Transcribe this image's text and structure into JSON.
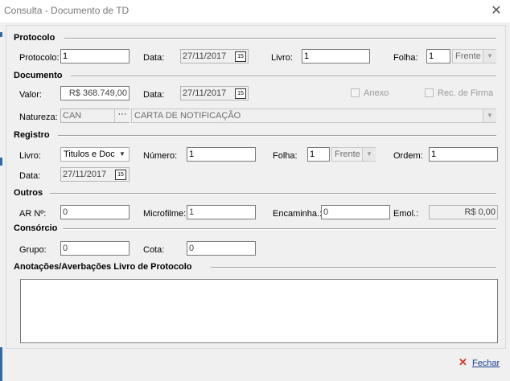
{
  "window": {
    "title": "Consulta - Documento de TD"
  },
  "sections": {
    "protocolo": "Protocolo",
    "documento": "Documento",
    "registro": "Registro",
    "outros": "Outros",
    "consorcio": "Consórcio",
    "anotacoes": "Anotações/Averbações Livro de Protocolo"
  },
  "protocolo": {
    "protocolo_label": "Protocolo:",
    "protocolo_value": "1",
    "data_label": "Data:",
    "data_value": "27/11/2017",
    "livro_label": "Livro:",
    "livro_value": "1",
    "folha_label": "Folha:",
    "folha_value": "1",
    "folha_side": "Frente"
  },
  "documento": {
    "valor_label": "Valor:",
    "valor_value": "R$ 368.749,00",
    "data_label": "Data:",
    "data_value": "27/11/2017",
    "anexo_label": "Anexo",
    "rec_firma_label": "Rec. de Firma",
    "natureza_label": "Natureza:",
    "natureza_code": "CAN",
    "natureza_desc": "CARTA DE NOTIFICAÇÃO"
  },
  "registro": {
    "livro_label": "Livro:",
    "livro_value": "Titulos e Doc",
    "numero_label": "Número:",
    "numero_value": "1",
    "folha_label": "Folha:",
    "folha_value": "1",
    "folha_side": "Frente",
    "ordem_label": "Ordem:",
    "ordem_value": "1",
    "data_label": "Data:",
    "data_value": "27/11/2017"
  },
  "outros": {
    "ar_label": "AR Nº:",
    "ar_value": "0",
    "microfilme_label": "Microfilme:",
    "microfilme_value": "1",
    "encaminha_label": "Encaminha.:",
    "encaminha_value": "0",
    "emol_label": "Emol.:",
    "emol_value": "R$ 0,00"
  },
  "consorcio": {
    "grupo_label": "Grupo:",
    "grupo_value": "0",
    "cota_label": "Cota:",
    "cota_value": "0"
  },
  "footer": {
    "fechar_label": "Fechar"
  },
  "icons": {
    "calendar": "15",
    "dropdown": "▼",
    "ellipsis": "···",
    "close": "✕"
  },
  "colors": {
    "accent_edge": "#2b6cb0",
    "fechar_icon": "#d9362b"
  }
}
